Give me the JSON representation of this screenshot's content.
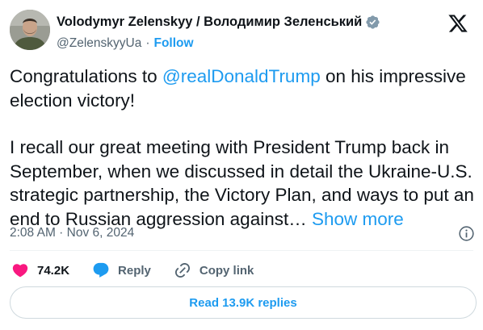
{
  "author": {
    "display_name": "Volodymyr Zelenskyy / Володимир Зеленський",
    "handle": "@ZelenskyyUa",
    "separator": "·",
    "follow_label": "Follow",
    "verified": true
  },
  "tweet": {
    "para1_before": "Congratulations to ",
    "mention": "@realDonaldTrump",
    "para1_after": " on his impressive election victory!",
    "para2": "I recall our great meeting with President Trump back in September, when we discussed in detail the Ukraine-U.S. strategic partnership, the Victory Plan, and ways to put an end to Russian aggression against… ",
    "show_more": "Show more"
  },
  "meta": {
    "time": "2:08 AM",
    "separator": " · ",
    "date": "Nov 6, 2024"
  },
  "actions": {
    "likes": "74.2K",
    "reply_label": "Reply",
    "copy_link_label": "Copy link"
  },
  "replies_button": "Read 13.9K replies",
  "colors": {
    "accent": "#1d9bf0",
    "like": "#f91880",
    "verified": "#829aab",
    "text": "#0f1419",
    "secondary": "#536471"
  },
  "icons": {
    "logo": "x-logo-icon",
    "verified": "verified-badge-icon",
    "info": "info-icon",
    "like": "heart-icon",
    "reply": "speech-bubble-icon",
    "copy": "link-icon"
  }
}
